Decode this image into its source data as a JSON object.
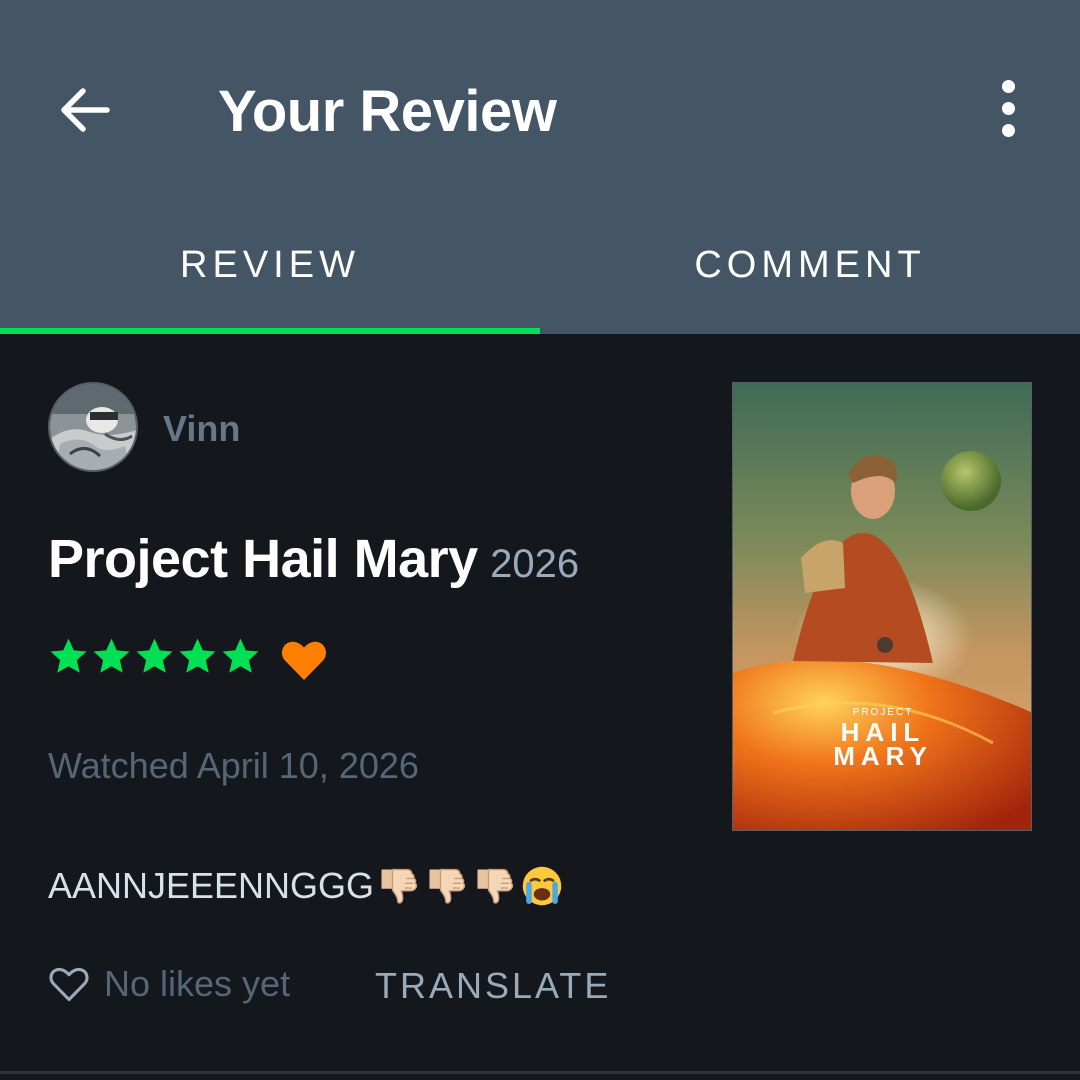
{
  "header": {
    "title": "Your Review"
  },
  "tabs": [
    {
      "label": "REVIEW",
      "active": true
    },
    {
      "label": "COMMENT",
      "active": false
    }
  ],
  "reviewer": {
    "name": "Vinn"
  },
  "film": {
    "title": "Project Hail Mary",
    "year": "2026",
    "poster_text_small": "PROJECT",
    "poster_text_line1": "HAIL",
    "poster_text_line2": "MARY"
  },
  "rating": {
    "stars": 5,
    "max": 5,
    "liked": true
  },
  "watched": "Watched April 10, 2026",
  "review": {
    "text": "AANNJEEENNGGG",
    "emojis": [
      "thumbs-down-icon",
      "thumbs-down-icon",
      "thumbs-down-icon",
      "loudly-crying-face-icon"
    ]
  },
  "actions": {
    "likes_label": "No likes yet",
    "translate_label": "TRANSLATE"
  },
  "colors": {
    "header_bg": "#445566",
    "page_bg": "#14181c",
    "accent_green": "#00e054",
    "heart_orange": "#ff8000",
    "muted_text": "#556677"
  }
}
